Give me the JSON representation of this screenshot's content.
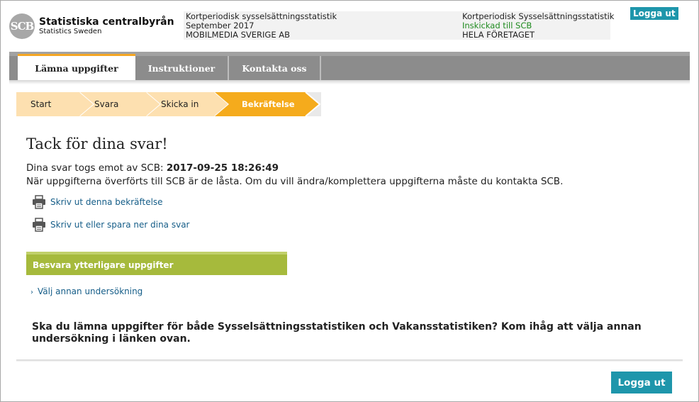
{
  "header": {
    "logo_mark": "SCB",
    "logo_name": "Statistiska centralbyrån",
    "logo_sub": "Statistics Sweden",
    "survey_left": "Kortperiodisk sysselsättningsstatistik",
    "period": "September 2017",
    "company": "MOBILMEDIA SVERIGE AB",
    "survey_right": "Kortperiodisk Sysselsättningsstatistik",
    "status": "Inskickad till SCB",
    "scope": "HELA FÖRETAGET",
    "logout_label": "Logga ut"
  },
  "nav": {
    "tabs": [
      {
        "label": "Lämna uppgifter"
      },
      {
        "label": "Instruktioner"
      },
      {
        "label": "Kontakta oss"
      }
    ]
  },
  "steps": [
    {
      "label": "Start"
    },
    {
      "label": "Svara"
    },
    {
      "label": "Skicka in"
    },
    {
      "label": "Bekräftelse"
    }
  ],
  "main": {
    "title": "Tack för dina svar!",
    "received_prefix": "Dina svar togs emot av SCB:",
    "received_time": "2017-09-25 18:26:49",
    "locked_text": "När uppgifterna överförts till SCB är de låsta. Om du vill ändra/komplettera uppgifterna måste du kontakta SCB.",
    "print_confirmation": "Skriv ut denna bekräftelse",
    "print_answers": "Skriv ut eller spara ner dina svar",
    "section_title": "Besvara ytterligare uppgifter",
    "choose_survey": "Välj annan undersökning",
    "note": "Ska du lämna uppgifter för både Sysselsättningsstatistiken och Vakansstatistiken? Kom ihåg att välja annan undersökning i länken ovan."
  },
  "footer": {
    "logout_label": "Logga ut"
  },
  "colors": {
    "accent_teal": "#1e96ab",
    "step_inactive": "#fde0b0",
    "step_active": "#f5ab1c",
    "section_green": "#a6ba3c",
    "link_blue": "#155d88",
    "status_green": "#1f8a1f"
  }
}
